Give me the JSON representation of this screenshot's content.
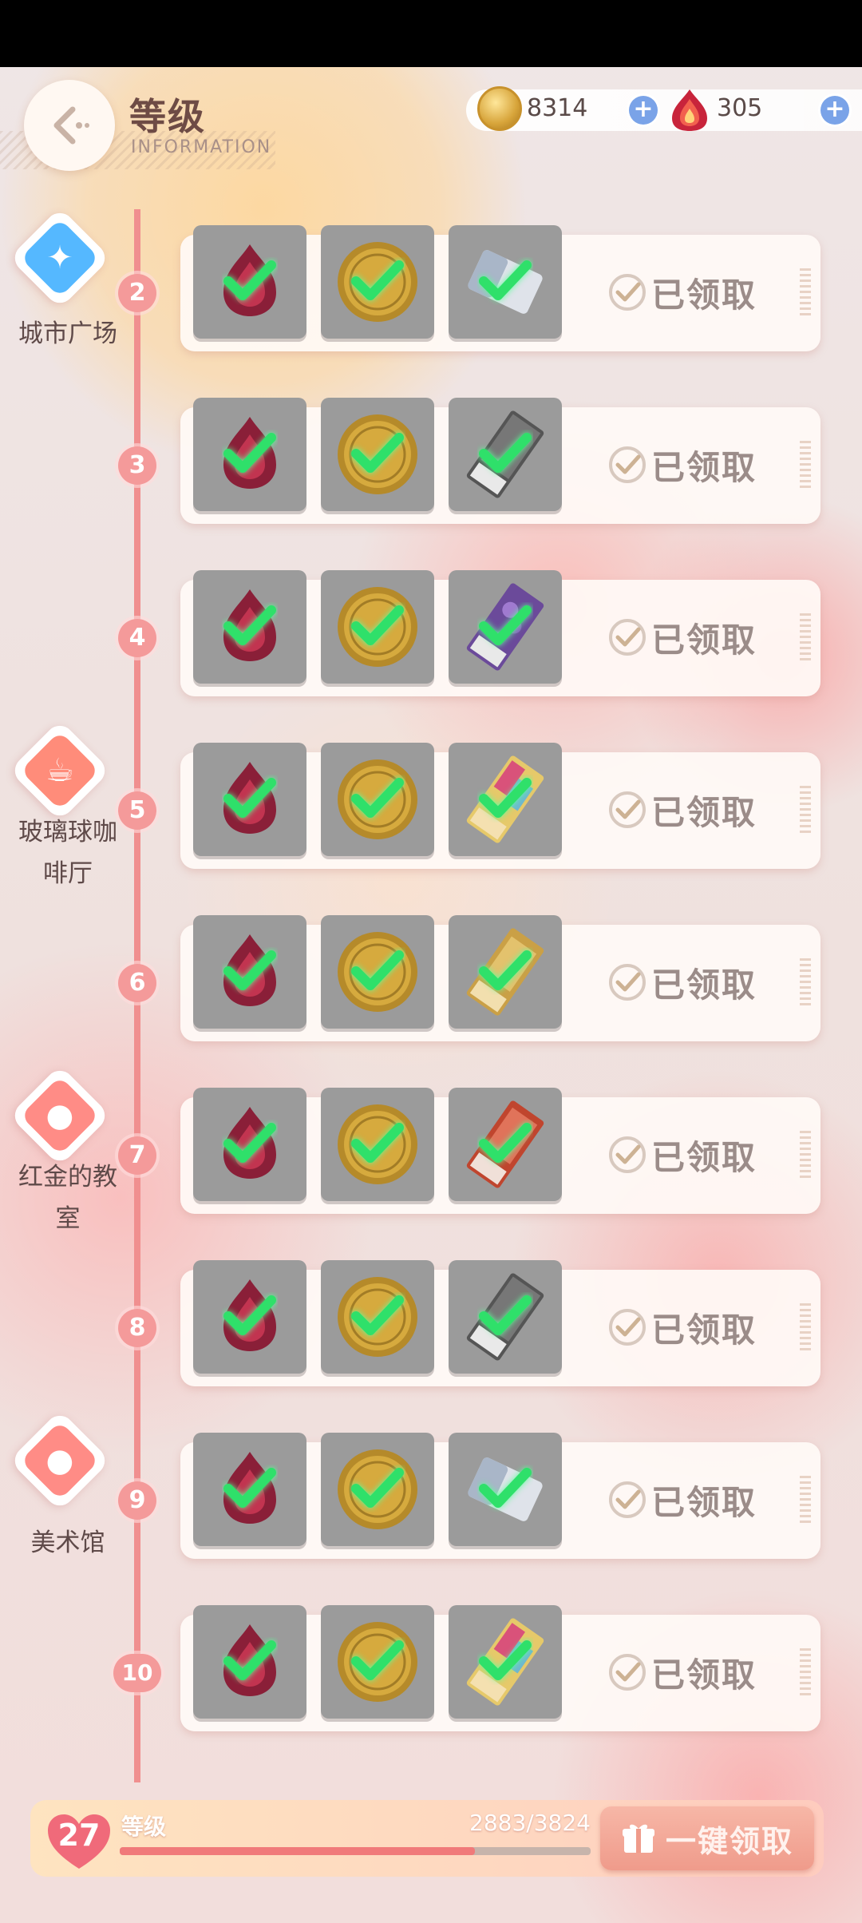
{
  "header": {
    "title": "等级",
    "subtitle": "INFORMATION",
    "back_icon": "back-arrow-icon"
  },
  "currency": {
    "coins": "8314",
    "gems": "305"
  },
  "locations": [
    {
      "name": "城市广场",
      "lines": [
        "城市广场"
      ],
      "icon": "crystal-icon",
      "color": "#55b8ff"
    },
    {
      "name": "玻璃球咖啡厅",
      "lines": [
        "玻璃球咖",
        "啡厅"
      ],
      "icon": "coffee-cup-icon",
      "color": "#ff8c7a"
    },
    {
      "name": "红金的教室",
      "lines": [
        "红金的教",
        "室"
      ],
      "icon": "palette-icon",
      "color": "#ff8c86"
    },
    {
      "name": "美术馆",
      "lines": [
        "美术馆"
      ],
      "icon": "palette-icon",
      "color": "#ff8c86"
    }
  ],
  "rows": [
    {
      "level": "2",
      "status": "已领取",
      "item3": "eraser"
    },
    {
      "level": "3",
      "status": "已领取",
      "item3": "card-gray"
    },
    {
      "level": "4",
      "status": "已领取",
      "item3": "card-purple"
    },
    {
      "level": "5",
      "status": "已领取",
      "item3": "card-colorful"
    },
    {
      "level": "6",
      "status": "已领取",
      "item3": "card-gold"
    },
    {
      "level": "7",
      "status": "已领取",
      "item3": "card-red"
    },
    {
      "level": "8",
      "status": "已领取",
      "item3": "card-gray"
    },
    {
      "level": "9",
      "status": "已领取",
      "item3": "eraser"
    },
    {
      "level": "10",
      "status": "已领取",
      "item3": "card-colorful"
    }
  ],
  "footer": {
    "level": "27",
    "level_label": "等级",
    "exp_text": "2883/3824",
    "exp_progress": 0.754,
    "claim_all_label": "一键领取"
  },
  "colors": {
    "accent": "#f08f8f",
    "check": "#3ff07a"
  }
}
